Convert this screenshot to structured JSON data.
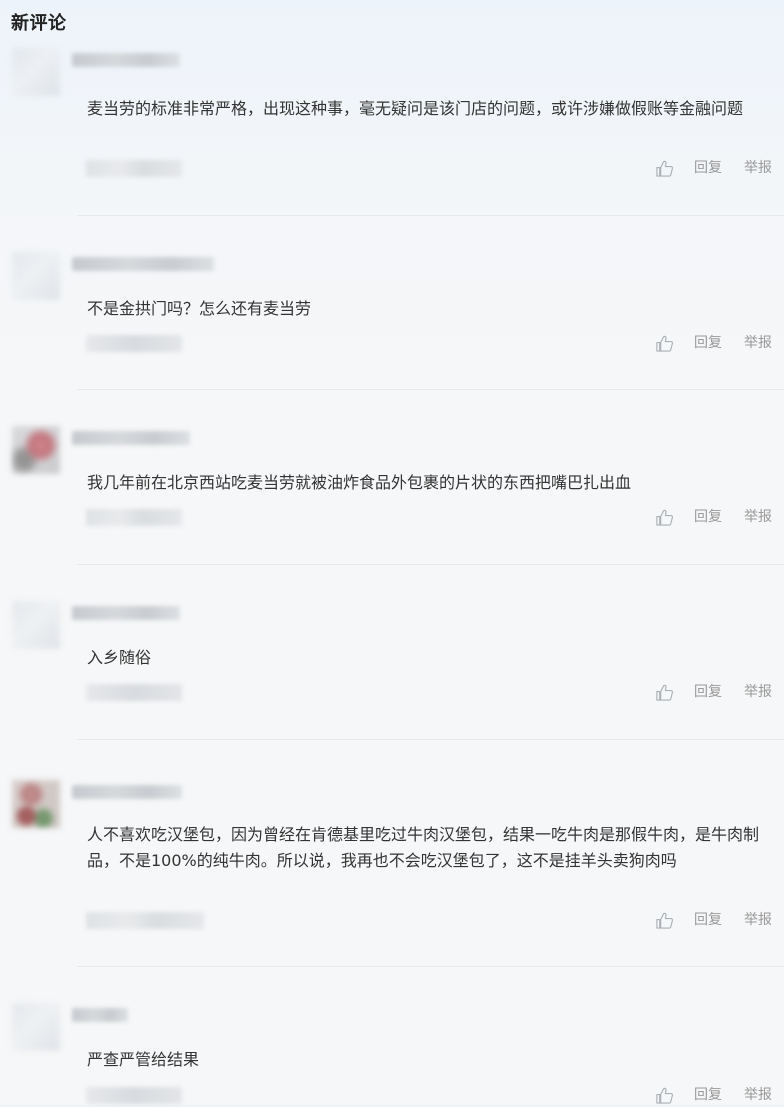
{
  "section": {
    "title": "新评论"
  },
  "actions": {
    "reply_label": "回复",
    "report_label": "举报",
    "like_icon": "thumbs-up-icon"
  },
  "comments": [
    {
      "text": "麦当劳的标准非常严格，出现这种事，毫无疑问是该门店的问题，或许涉嫌做假账等金融问题"
    },
    {
      "text": "不是金拱门吗？怎么还有麦当劳"
    },
    {
      "text": "我几年前在北京西站吃麦当劳就被油炸食品外包裹的片状的东西把嘴巴扎出血"
    },
    {
      "text": "入乡随俗"
    },
    {
      "text": "人不喜欢吃汉堡包，因为曾经在肯德基里吃过牛肉汉堡包，结果一吃牛肉是那假牛肉，是牛肉制品，不是100%的纯牛肉。所以说，我再也不会吃汉堡包了，这不是挂羊头卖狗肉吗"
    },
    {
      "text": "严查严管给结果"
    }
  ]
}
